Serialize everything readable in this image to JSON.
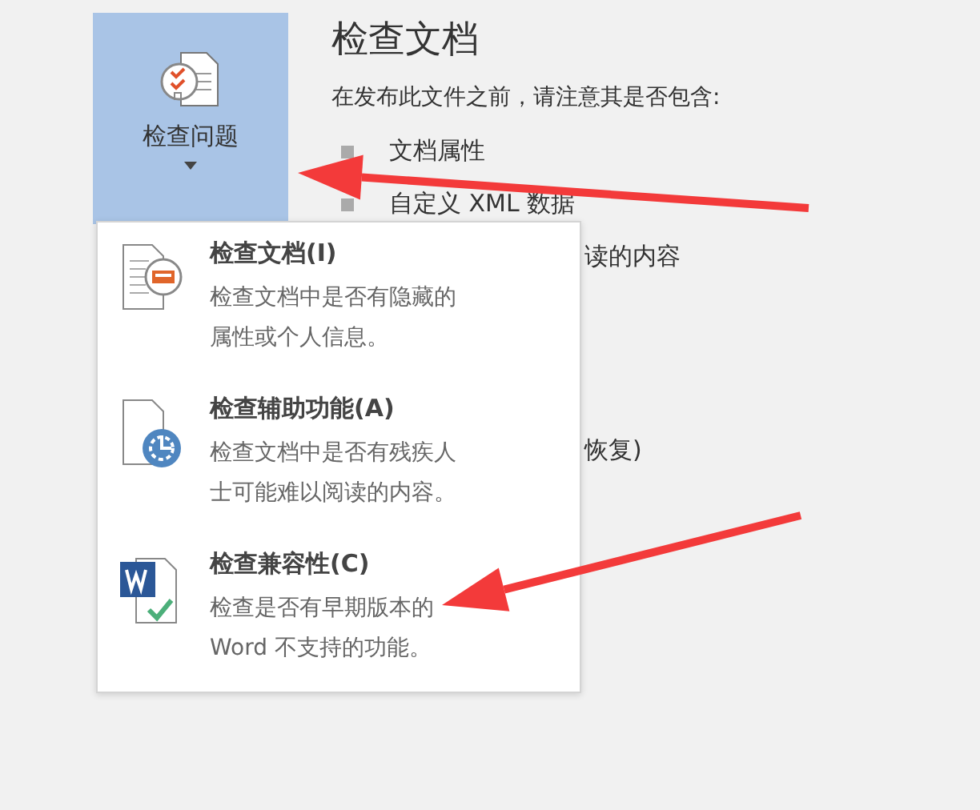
{
  "inspect_button": {
    "label": "检查问题",
    "expanded": true
  },
  "panel": {
    "title": "检查文档",
    "description": "在发布此文件之前，请注意其是否包含:",
    "items": [
      {
        "text": "文档属性"
      },
      {
        "text": "自定义 XML 数据"
      }
    ],
    "partly_hidden_items": [
      "读的内容",
      "恢复)"
    ]
  },
  "menu": {
    "items": [
      {
        "kind": "inspect",
        "title": "检查文档(I)",
        "description": "检查文档中是否有隐藏的属性或个人信息。"
      },
      {
        "kind": "accessibility",
        "title": "检查辅助功能(A)",
        "description": "检查文档中是否有残疾人士可能难以阅读的内容。"
      },
      {
        "kind": "compatibility",
        "title": "检查兼容性(C)",
        "description": "检查是否有早期版本的 Word 不支持的功能。"
      }
    ]
  },
  "annotations": [
    {
      "kind": "arrow"
    },
    {
      "kind": "arrow"
    }
  ]
}
